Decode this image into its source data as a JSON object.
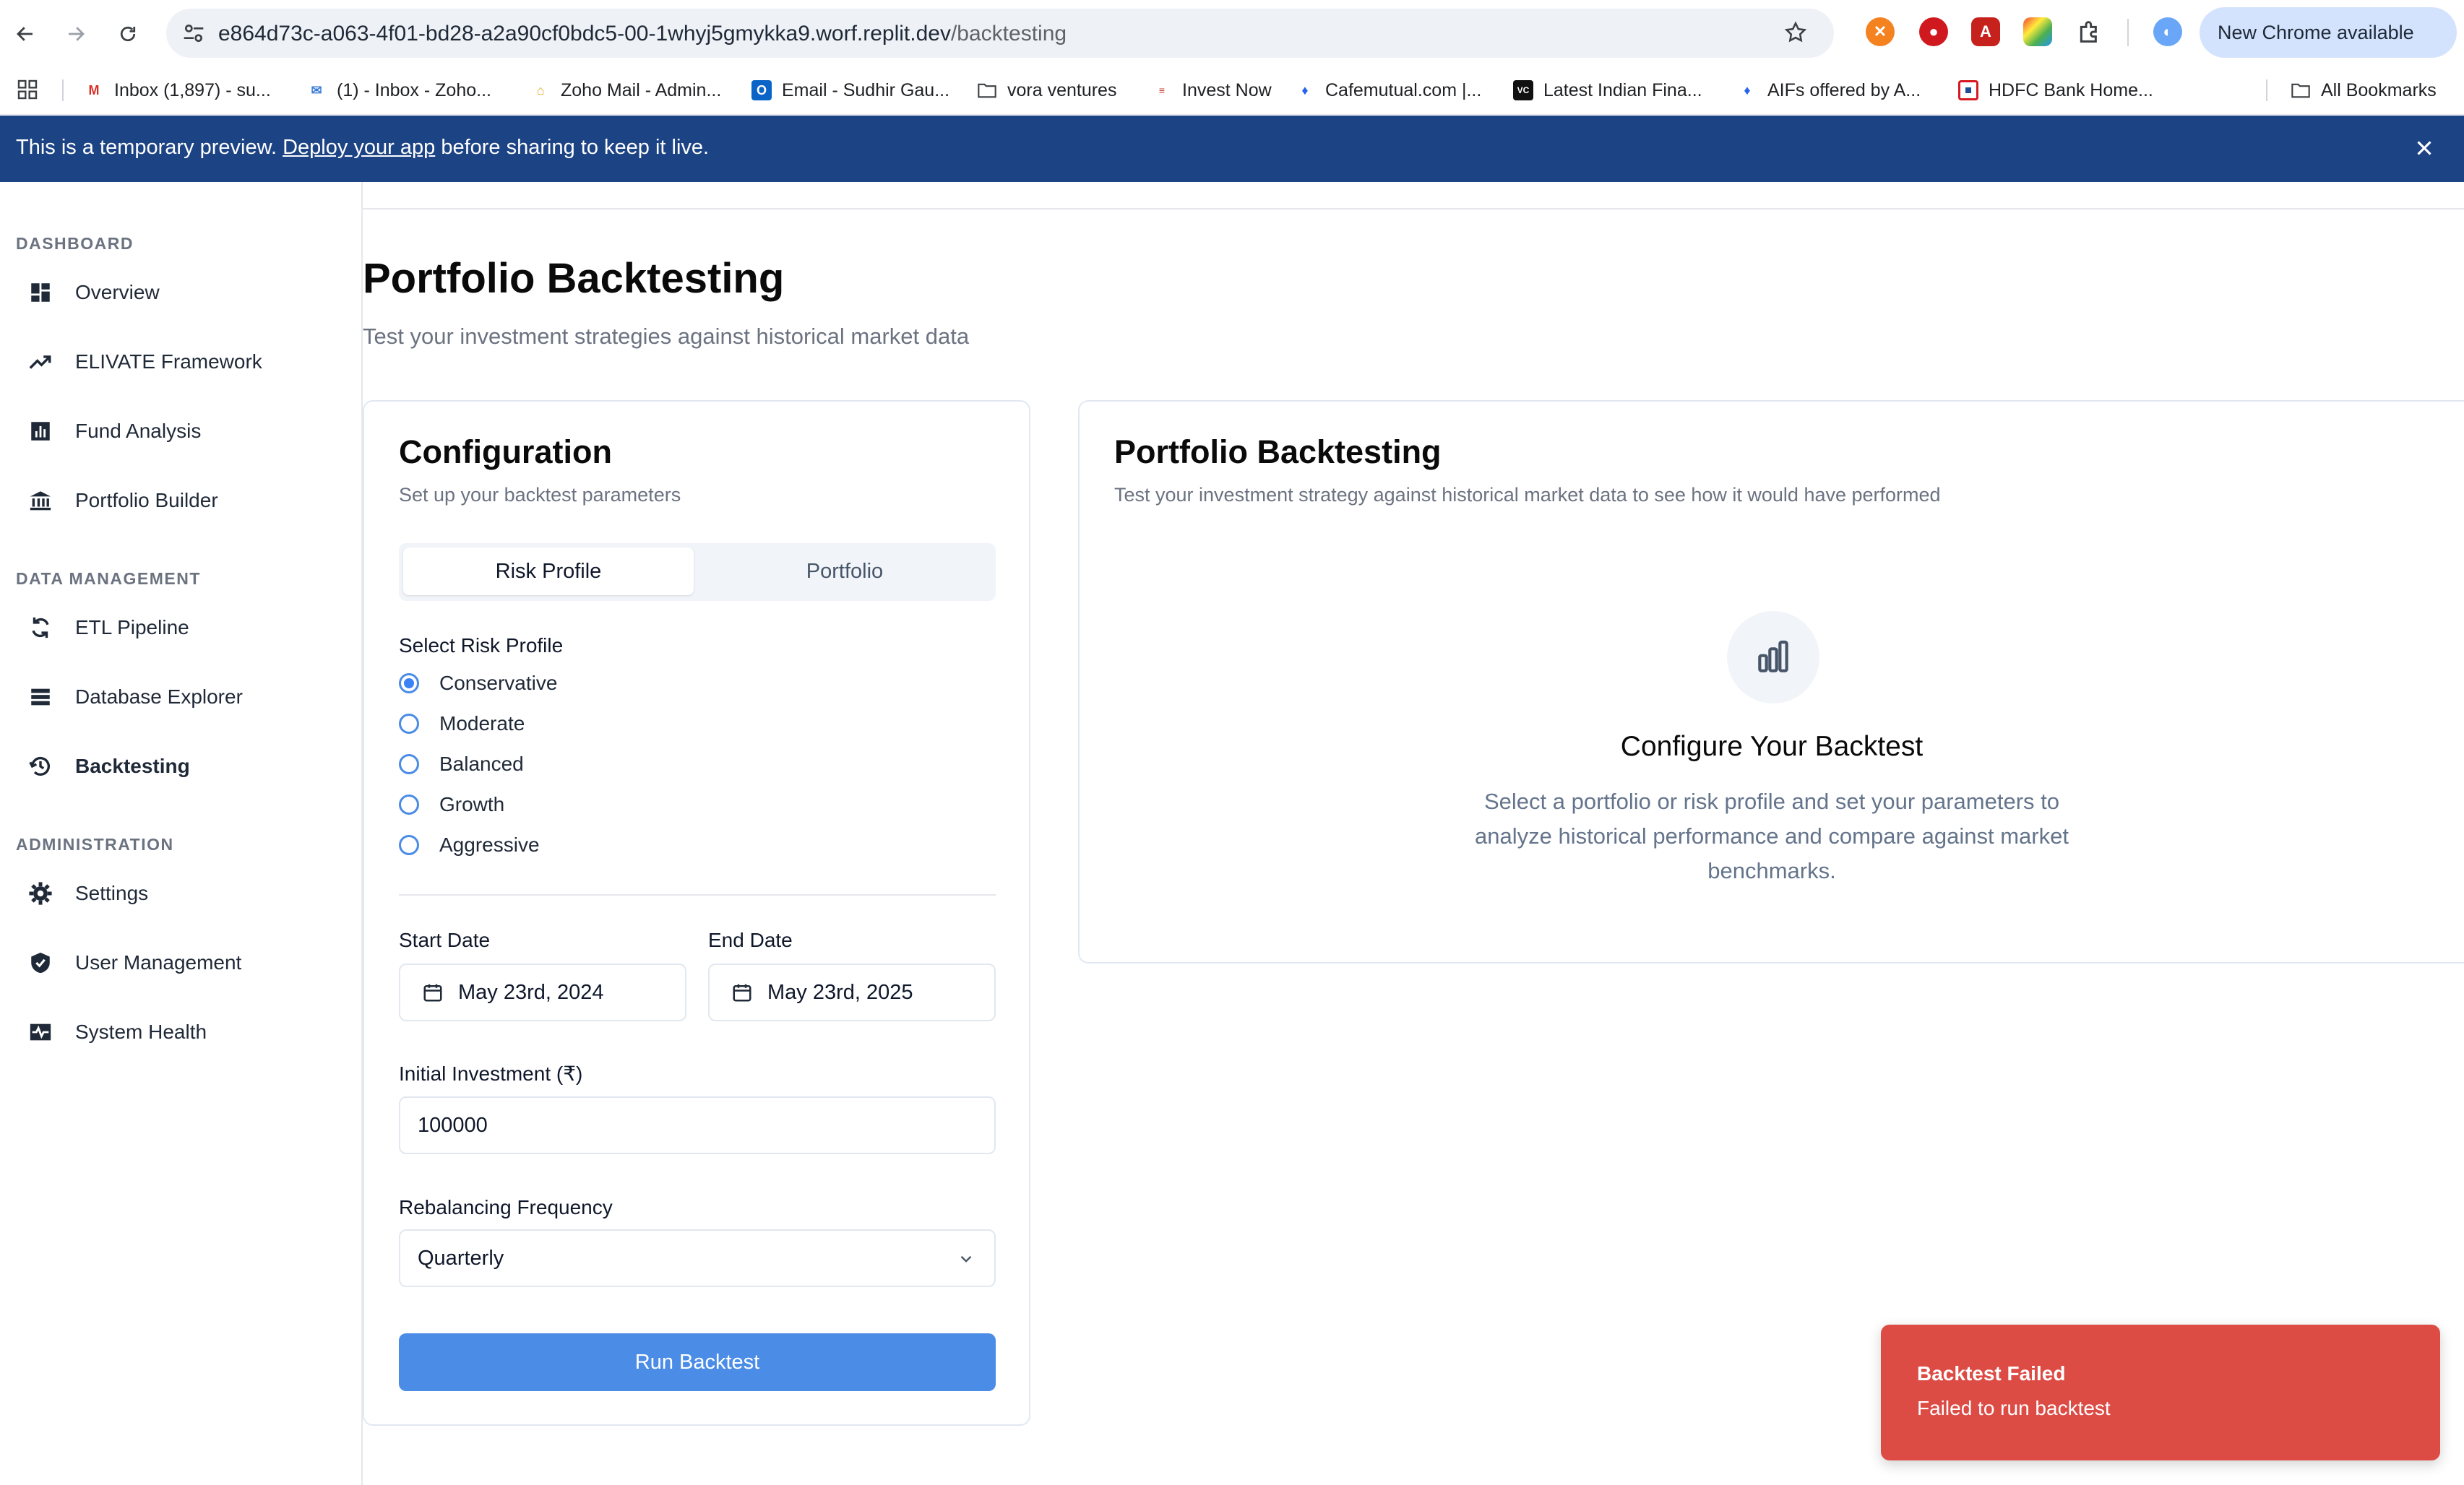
{
  "browser": {
    "url_host": "e864d73c-a063-4f01-bd28-a2a90cf0bdc5-00-1whyj5gmykka9.worf.replit.dev",
    "url_path": "/backtesting",
    "update_button": "New Chrome available",
    "bookmarks": [
      {
        "label": "Inbox (1,897) - su...",
        "icon": "gmail-icon"
      },
      {
        "label": "(1) - Inbox - Zoho...",
        "icon": "zoho-inbox-icon"
      },
      {
        "label": "Zoho Mail - Admin...",
        "icon": "zoho-mail-icon"
      },
      {
        "label": "Email - Sudhir Gau...",
        "icon": "outlook-icon"
      },
      {
        "label": "vora ventures",
        "icon": "folder-icon"
      },
      {
        "label": "Invest Now",
        "icon": "invest-icon"
      },
      {
        "label": "Cafemutual.com |...",
        "icon": "cafemutual-icon"
      },
      {
        "label": "Latest Indian Fina...",
        "icon": "vccircle-icon"
      },
      {
        "label": "AIFs offered by A...",
        "icon": "aif-icon"
      },
      {
        "label": "HDFC Bank Home...",
        "icon": "hdfc-icon"
      }
    ],
    "all_bookmarks": "All Bookmarks"
  },
  "banner": {
    "prefix": "This is a temporary preview. ",
    "link": "Deploy your app",
    "suffix": " before sharing to keep it live."
  },
  "sidebar": {
    "sections": [
      {
        "label": "DASHBOARD",
        "items": [
          {
            "label": "Overview",
            "icon": "dashboard-grid-icon"
          },
          {
            "label": "ELIVATE Framework",
            "icon": "trending-up-icon"
          },
          {
            "label": "Fund Analysis",
            "icon": "bar-chart-icon"
          },
          {
            "label": "Portfolio Builder",
            "icon": "bank-icon"
          }
        ]
      },
      {
        "label": "DATA MANAGEMENT",
        "items": [
          {
            "label": "ETL Pipeline",
            "icon": "refresh-icon"
          },
          {
            "label": "Database Explorer",
            "icon": "database-list-icon"
          },
          {
            "label": "Backtesting",
            "icon": "history-icon"
          }
        ]
      },
      {
        "label": "ADMINISTRATION",
        "items": [
          {
            "label": "Settings",
            "icon": "gear-icon"
          },
          {
            "label": "User Management",
            "icon": "shield-icon"
          },
          {
            "label": "System Health",
            "icon": "monitor-pulse-icon"
          }
        ]
      }
    ],
    "active": "Backtesting"
  },
  "page": {
    "title": "Portfolio Backtesting",
    "subtitle": "Test your investment strategies against historical market data"
  },
  "config": {
    "title": "Configuration",
    "subtitle": "Set up your backtest parameters",
    "tabs": [
      "Risk Profile",
      "Portfolio"
    ],
    "active_tab": "Risk Profile",
    "risk_label": "Select Risk Profile",
    "risk_options": [
      "Conservative",
      "Moderate",
      "Balanced",
      "Growth",
      "Aggressive"
    ],
    "selected_risk": "Conservative",
    "start_label": "Start Date",
    "start_value": "May 23rd, 2024",
    "end_label": "End Date",
    "end_value": "May 23rd, 2025",
    "investment_label": "Initial Investment (₹)",
    "investment_value": "100000",
    "rebalance_label": "Rebalancing Frequency",
    "rebalance_value": "Quarterly",
    "run_button": "Run Backtest"
  },
  "results": {
    "title": "Portfolio Backtesting",
    "subtitle": "Test your investment strategy against historical market data to see how it would have performed",
    "empty_title": "Configure Your Backtest",
    "empty_body": "Select a portfolio or risk profile and set your parameters to analyze historical performance and compare against market benchmarks."
  },
  "toast": {
    "title": "Backtest Failed",
    "message": "Failed to run backtest",
    "color": "#dd4b45"
  },
  "colors": {
    "banner": "#1c4384",
    "accent": "#4a8ce6"
  }
}
